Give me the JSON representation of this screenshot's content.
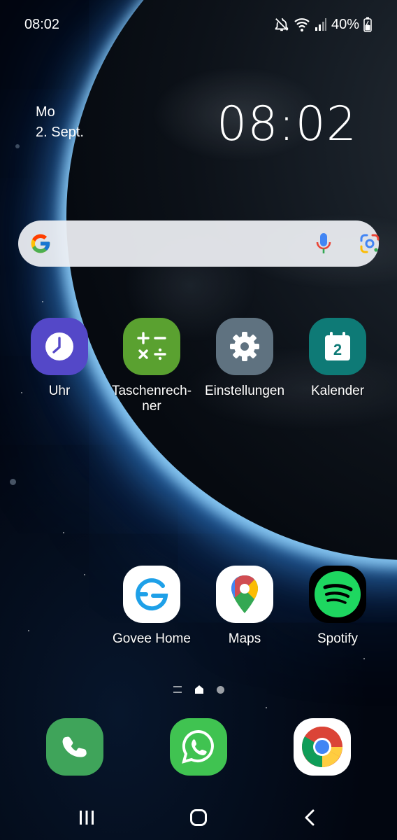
{
  "status_bar": {
    "time": "08:02",
    "battery": "40%",
    "icons": [
      "mute-icon",
      "wifi-icon",
      "signal-icon",
      "battery-icon"
    ]
  },
  "date_widget": {
    "weekday": "Mo",
    "date": "2. Sept."
  },
  "clock_widget": {
    "time": "08:02"
  },
  "search_bar": {
    "icons": [
      "google-icon",
      "mic-icon",
      "google-lens-icon"
    ]
  },
  "apps_row1": [
    {
      "label": "Uhr",
      "icon": "clock-icon",
      "color": "#5448c8"
    },
    {
      "label": "Taschenrech-\nner",
      "icon": "calculator-icon",
      "color": "#5aa130"
    },
    {
      "label": "Einstellungen",
      "icon": "gear-icon",
      "color": "#5f7280"
    },
    {
      "label": "Kalender",
      "icon": "calendar-icon",
      "color": "#0e7a76",
      "badge": "2"
    }
  ],
  "apps_row2": [
    {
      "label": "Govee Home",
      "icon": "govee-icon",
      "color": "#ffffff"
    },
    {
      "label": "Maps",
      "icon": "maps-icon",
      "color": "#ffffff"
    },
    {
      "label": "Spotify",
      "icon": "spotify-icon",
      "color": "#1ed760"
    }
  ],
  "dock": [
    {
      "icon": "phone-icon",
      "color": "#3fa45a"
    },
    {
      "icon": "whatsapp-icon",
      "color": "#40c351"
    },
    {
      "icon": "chrome-icon",
      "color": "#ffffff"
    }
  ],
  "page_indicator": {
    "pages": [
      "menu-lines",
      "home",
      "dot"
    ],
    "active": "home"
  },
  "nav_bar": {
    "buttons": [
      "recent-apps-button",
      "home-button",
      "back-button"
    ]
  }
}
